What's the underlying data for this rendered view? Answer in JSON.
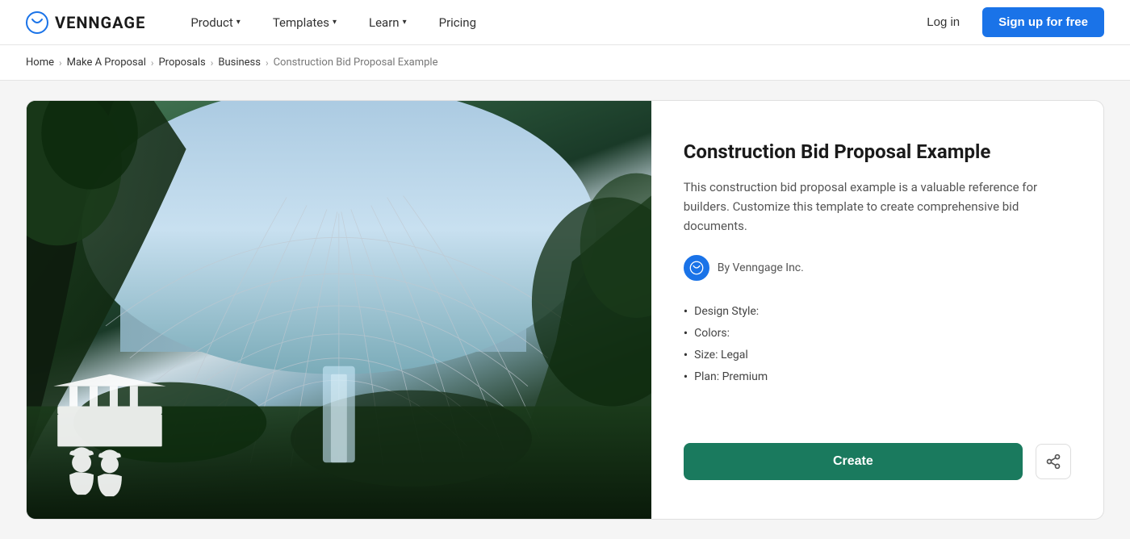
{
  "header": {
    "logo_text": "VENNGAGE",
    "nav": [
      {
        "label": "Product",
        "id": "product"
      },
      {
        "label": "Templates",
        "id": "templates"
      },
      {
        "label": "Learn",
        "id": "learn"
      },
      {
        "label": "Pricing",
        "id": "pricing"
      }
    ],
    "login_label": "Log in",
    "signup_label": "Sign up for free"
  },
  "breadcrumb": {
    "items": [
      {
        "label": "Home",
        "link": true
      },
      {
        "label": "Make A Proposal",
        "link": true
      },
      {
        "label": "Proposals",
        "link": true
      },
      {
        "label": "Business",
        "link": true
      },
      {
        "label": "Construction Bid Proposal Example",
        "link": false
      }
    ]
  },
  "template": {
    "title": "Construction Bid Proposal Example",
    "description": "This construction bid proposal example is a valuable reference for builders. Customize this template to create comprehensive bid documents.",
    "author": "By Venngage Inc.",
    "details": [
      {
        "label": "Design Style:"
      },
      {
        "label": "Colors:"
      },
      {
        "label": "Size: Legal"
      },
      {
        "label": "Plan: Premium"
      }
    ],
    "create_label": "Create",
    "share_label": "Share"
  }
}
